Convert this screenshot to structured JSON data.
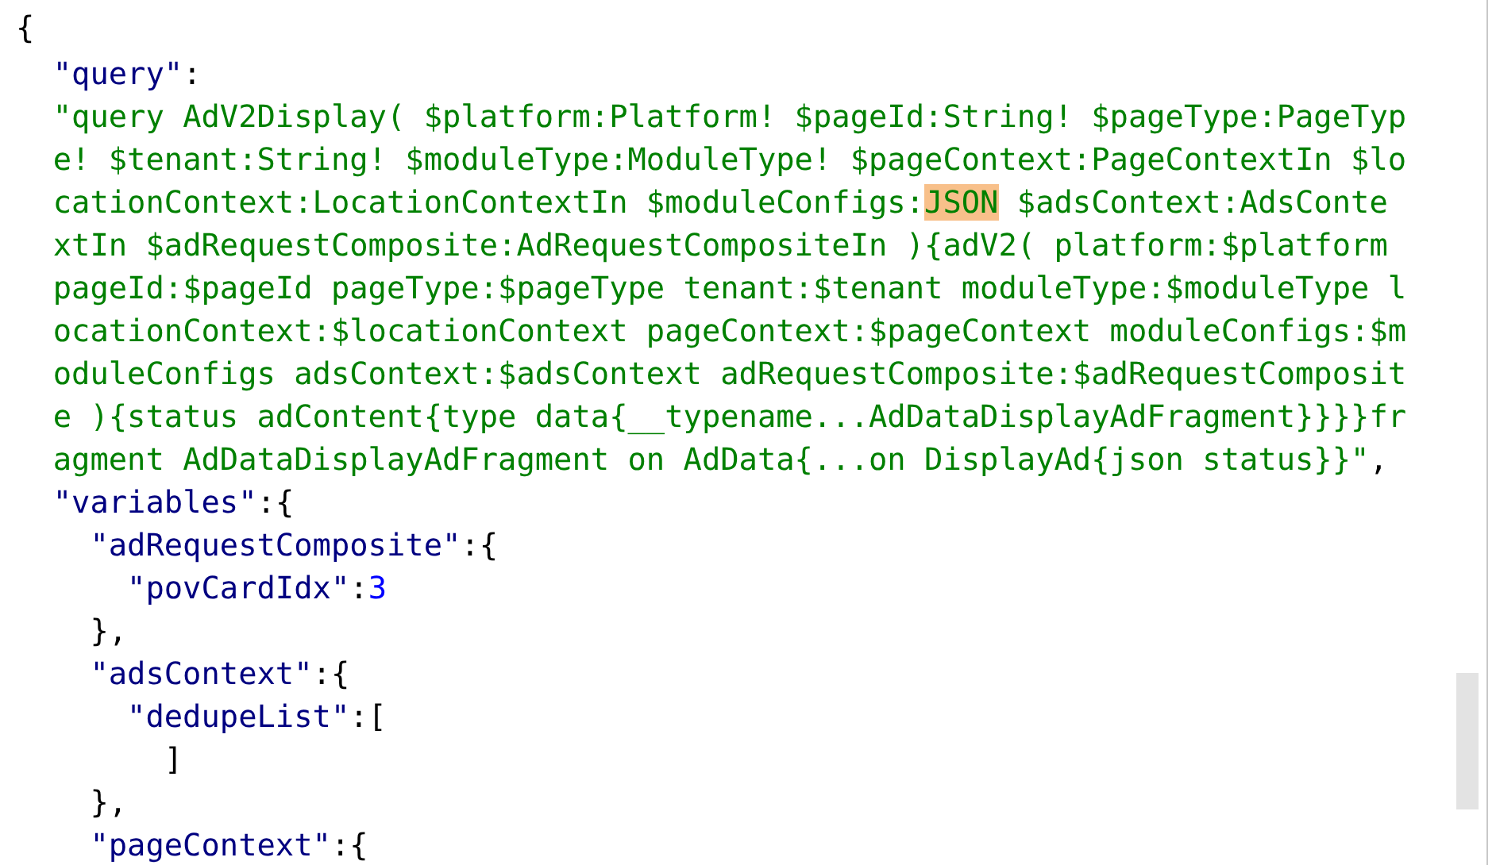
{
  "lines": [
    {
      "tokens": [
        {
          "kind": "punct",
          "text": "{"
        }
      ],
      "children": [
        {
          "tokens": [
            {
              "kind": "key",
              "text": "\"query\""
            },
            {
              "kind": "punct",
              "text": ":"
            }
          ]
        },
        {
          "tokens": [
            {
              "kind": "string",
              "segments": [
                {
                  "text": "\"query AdV2Display( $platform:Platform! $pageId:String! $pageType:PageType! $tenant:String! $moduleType:ModuleType! $pageContext:PageContextIn $locationContext:LocationContextIn $moduleConfigs:",
                  "highlighted": false
                },
                {
                  "text": "JSON",
                  "highlighted": true
                },
                {
                  "text": " $adsContext:AdsContextIn $adRequestComposite:AdRequestCompositeIn ){adV2( platform:$platform pageId:$pageId pageType:$pageType tenant:$tenant moduleType:$moduleType locationContext:$locationContext pageContext:$pageContext moduleConfigs:$moduleConfigs adsContext:$adsContext adRequestComposite:$adRequestComposite ){status adContent{type data{__typename...AdDataDisplayAdFragment}}}}fragment AdDataDisplayAdFragment on AdData{...on DisplayAd{json status}}\"",
                  "highlighted": false
                }
              ]
            },
            {
              "kind": "punct",
              "text": ","
            }
          ]
        },
        {
          "tokens": [
            {
              "kind": "key",
              "text": "\"variables\""
            },
            {
              "kind": "punct",
              "text": ":{"
            }
          ],
          "children": [
            {
              "tokens": [
                {
                  "kind": "key",
                  "text": "\"adRequestComposite\""
                },
                {
                  "kind": "punct",
                  "text": ":{"
                }
              ],
              "children": [
                {
                  "tokens": [
                    {
                      "kind": "key",
                      "text": "\"povCardIdx\""
                    },
                    {
                      "kind": "punct",
                      "text": ":"
                    },
                    {
                      "kind": "number",
                      "text": "3"
                    }
                  ]
                }
              ]
            },
            {
              "tokens": [
                {
                  "kind": "punct",
                  "text": "},"
                }
              ]
            },
            {
              "tokens": [
                {
                  "kind": "key",
                  "text": "\"adsContext\""
                },
                {
                  "kind": "punct",
                  "text": ":{"
                }
              ],
              "children": [
                {
                  "tokens": [
                    {
                      "kind": "key",
                      "text": "\"dedupeList\""
                    },
                    {
                      "kind": "punct",
                      "text": ":["
                    }
                  ]
                },
                {
                  "tokens": [
                    {
                      "kind": "punct",
                      "text": "]"
                    }
                  ],
                  "indented": true
                }
              ]
            },
            {
              "tokens": [
                {
                  "kind": "punct",
                  "text": "},"
                }
              ]
            },
            {
              "tokens": [
                {
                  "kind": "key",
                  "text": "\"pageContext\""
                },
                {
                  "kind": "punct",
                  "text": ":{"
                }
              ]
            }
          ]
        }
      ]
    }
  ]
}
